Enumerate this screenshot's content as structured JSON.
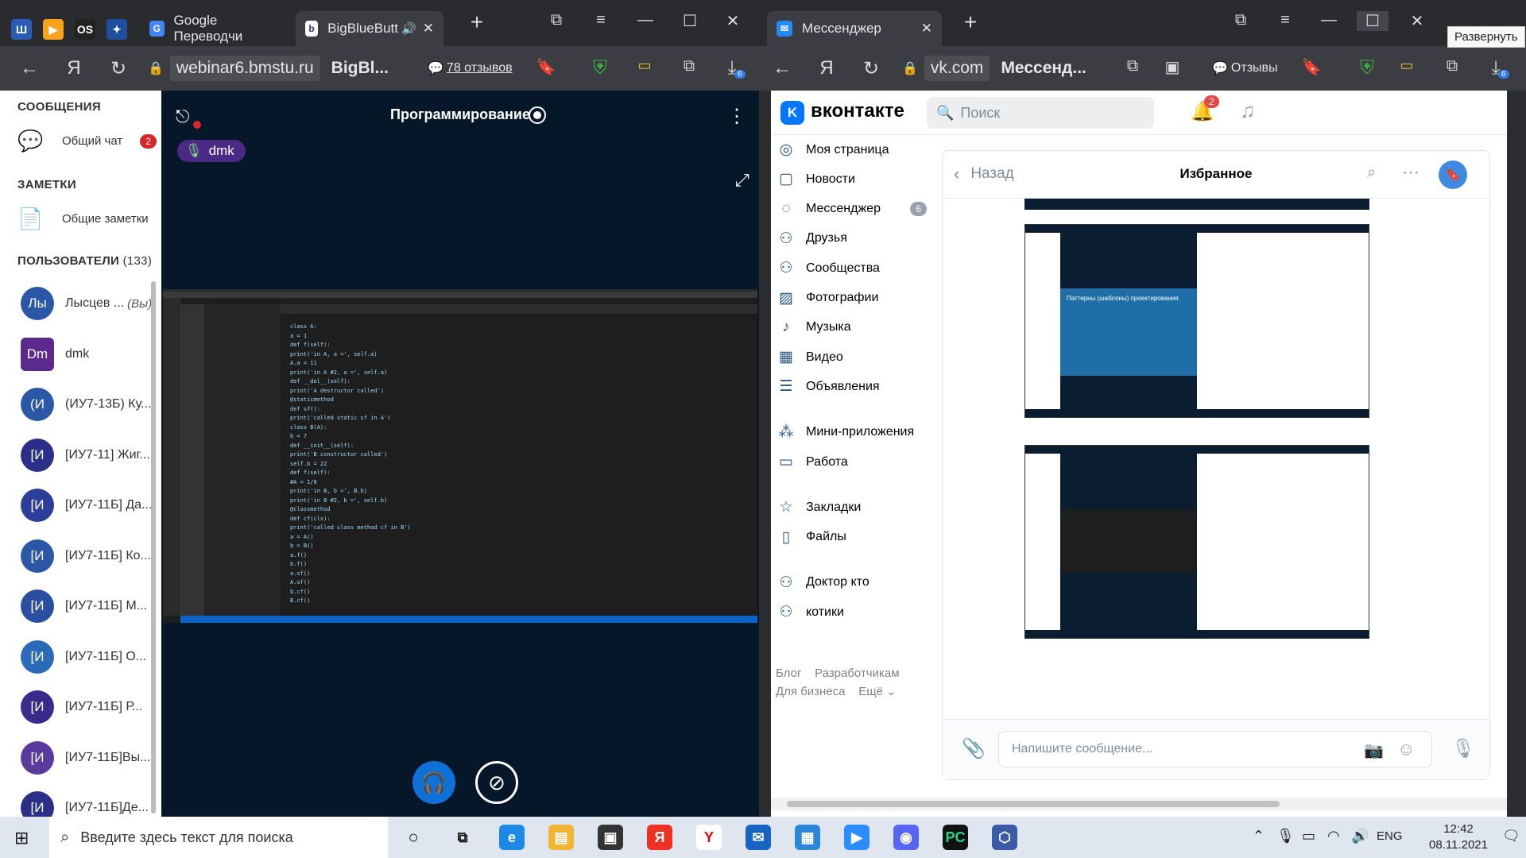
{
  "left_browser": {
    "tabs": [
      {
        "label": "Google Переводчи"
      },
      {
        "label": "BigBlueButton"
      }
    ],
    "url_domain": "webinar6.bmstu.ru",
    "url_title": "BigBl...",
    "reviews_label": "78 отзывов",
    "download_badge": "6"
  },
  "bbb": {
    "messages_header": "СООБЩЕНИЯ",
    "public_chat_label": "Общий чат",
    "public_chat_badge": "2",
    "notes_header": "ЗАМЕТКИ",
    "shared_notes_label": "Общие заметки",
    "users_header": "ПОЛЬЗОВАТЕЛИ",
    "users_count": "(133)",
    "users": [
      {
        "initials": "Лы",
        "name": "Лысцев ...",
        "suffix": "(Вы)",
        "color": "#2b58a6"
      },
      {
        "initials": "Dm",
        "name": "dmk",
        "suffix": "",
        "color": "#5b2a8c"
      },
      {
        "initials": "(И",
        "name": "(ИУ7-13Б) Ку...",
        "suffix": "",
        "color": "#2b58a6"
      },
      {
        "initials": "[И",
        "name": "[ИУ7-11] Жиг...",
        "suffix": "",
        "color": "#2b2f8a"
      },
      {
        "initials": "[И",
        "name": "[ИУ7-11Б] Да...",
        "suffix": "",
        "color": "#2b3f9a"
      },
      {
        "initials": "[И",
        "name": "[ИУ7-11Б] Ко...",
        "suffix": "",
        "color": "#2b58a6"
      },
      {
        "initials": "[И",
        "name": "[ИУ7-11Б] М...",
        "suffix": "",
        "color": "#2b4fa0"
      },
      {
        "initials": "[И",
        "name": "[ИУ7-11Б] О...",
        "suffix": "",
        "color": "#2b6ab6"
      },
      {
        "initials": "[И",
        "name": "[ИУ7-11Б] Р...",
        "suffix": "",
        "color": "#3b2a8c"
      },
      {
        "initials": "[И",
        "name": "[ИУ7-11Б]Вы...",
        "suffix": "",
        "color": "#5b3aa0"
      },
      {
        "initials": "[И",
        "name": "[ИУ7-11Б]Де...",
        "suffix": "",
        "color": "#2b2f8a"
      }
    ],
    "presentation_title": "Программирование",
    "talker": "dmk",
    "screen_share": {
      "code_lines": [
        "class A:",
        "    a = 1",
        "    def f(self):",
        "        print('in A, a =', self.a)",
        "        A.a = 11",
        "        print('in A #2, a =', self.a)",
        "    def __del__(self):",
        "        print('A destructor called')",
        "    @staticmethod",
        "    def sf():",
        "        print('called static sf in A')",
        "class B(A):",
        "    b = 7",
        "    def __init__(self):",
        "        print('B constructor called')",
        "        self.b = 22",
        "    def f(self):",
        "        #A = 1/0",
        "        print('in B, b =', B.b)",
        "        print('in B #2, b =', self.b)",
        "    @classmethod",
        "    def cf(cls):",
        "        print('called class method cf in B')",
        "a = A()",
        "b = B()",
        "a.f()",
        "b.f()",
        "a.sf()",
        "A.sf()",
        "b.cf()",
        "B.cf()"
      ]
    }
  },
  "right_browser": {
    "tab_label": "Мессенджер",
    "url_domain": "vk.com",
    "url_title": "Мессенд...",
    "reviews_label": "Отзывы",
    "download_badge": "6",
    "tooltip": "Развернуть"
  },
  "vk": {
    "logo": "вконтакте",
    "search_placeholder": "Поиск",
    "notif_badge": "2",
    "menu": [
      {
        "icon": "◎",
        "label": "Моя страница",
        "badge": ""
      },
      {
        "icon": "▢",
        "label": "Новости",
        "badge": ""
      },
      {
        "icon": "◌",
        "label": "Мессенджер",
        "badge": "6"
      },
      {
        "icon": "⚇",
        "label": "Друзья",
        "badge": ""
      },
      {
        "icon": "⚇",
        "label": "Сообщества",
        "badge": ""
      },
      {
        "icon": "▨",
        "label": "Фотографии",
        "badge": ""
      },
      {
        "icon": "♪",
        "label": "Музыка",
        "badge": ""
      },
      {
        "icon": "▦",
        "label": "Видео",
        "badge": ""
      },
      {
        "icon": "☰",
        "label": "Объявления",
        "badge": ""
      },
      {
        "icon": "⁂",
        "label": "Мини-приложения",
        "badge": ""
      },
      {
        "icon": "▭",
        "label": "Работа",
        "badge": ""
      },
      {
        "icon": "☆",
        "label": "Закладки",
        "badge": ""
      },
      {
        "icon": "▯",
        "label": "Файлы",
        "badge": ""
      },
      {
        "icon": "⚇",
        "label": "Доктор кто",
        "badge": ""
      },
      {
        "icon": "⚇",
        "label": "котики",
        "badge": ""
      }
    ],
    "footer": [
      "Блог",
      "Разработчикам",
      "Для бизнеса",
      "Ещё ⌄"
    ],
    "chat": {
      "back_label": "Назад",
      "title": "Избранное",
      "thumb_slide_title": "Паттерны (шаблоны) проектирования",
      "input_placeholder": "Напишите сообщение..."
    }
  },
  "taskbar": {
    "search_placeholder": "Введите здесь текст для поиска",
    "lang": "ENG",
    "time": "12:42",
    "date": "08.11.2021"
  }
}
